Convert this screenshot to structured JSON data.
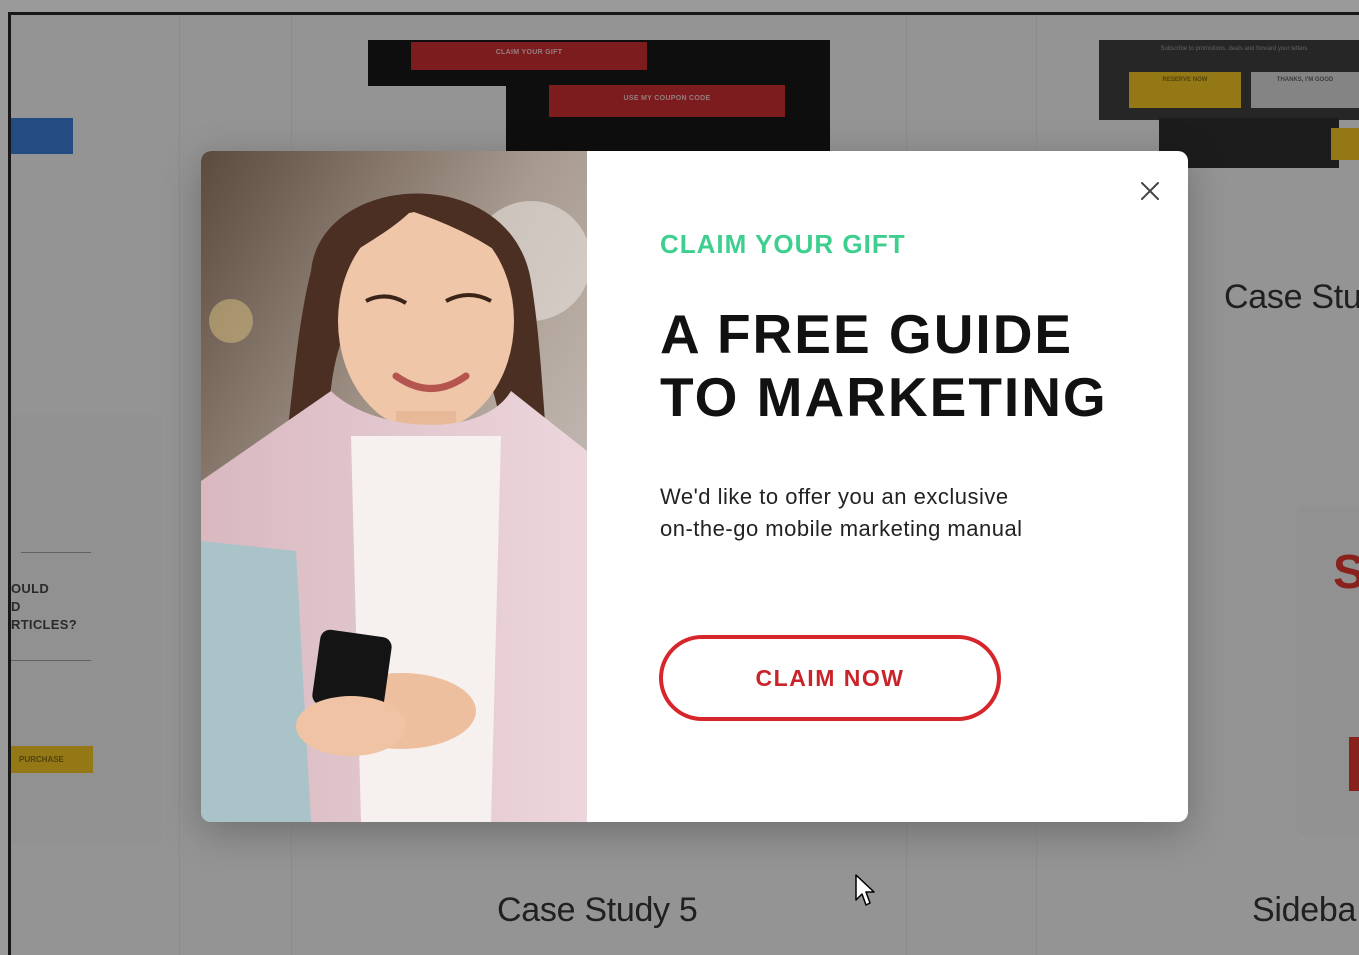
{
  "background": {
    "thumb_red_1": "CLAIM YOUR GIFT",
    "thumb_red_2": "USE MY COUPON CODE",
    "thumb_top_right_text": "Subscribe to promotions, deals and forward your letters",
    "thumb_yellow": "RESERVE NOW",
    "thumb_light": "THANKS, I'M GOOD",
    "left_question": [
      "OULD",
      "D",
      "RTICLES?"
    ],
    "left_yellow_button": "PURCHASE",
    "card_title_top_right": "Case Stu",
    "card_title_bottom_center": "Case Study 5",
    "card_title_bottom_right": "Sideba",
    "red_letter": "S"
  },
  "modal": {
    "eyebrow": "CLAIM YOUR GIFT",
    "headline_line1": "A FREE GUIDE",
    "headline_line2": "TO MARKETING",
    "body_line1": "We'd like to offer you an exclusive",
    "body_line2": "on-the-go mobile marketing manual",
    "cta_label": "CLAIM NOW",
    "close_icon": "close-icon",
    "photo_icon": "woman-with-phone-photo"
  },
  "colors": {
    "eyebrow": "#3ecf8e",
    "cta_border": "#d6262b",
    "overlay": "rgba(30,30,30,0.45)"
  }
}
